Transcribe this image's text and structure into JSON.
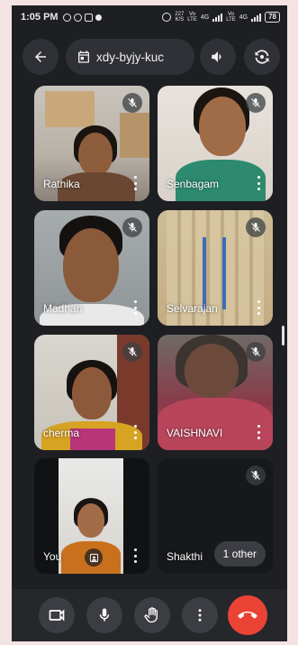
{
  "status_bar": {
    "time": "1:05 PM",
    "volte1_top": "227",
    "volte1_bottom": "K/S",
    "volte2_top": "Vo",
    "volte2_bottom": "LTE",
    "net1": "4G",
    "volte3_top": "Vo",
    "volte3_bottom": "LTE",
    "net2": "4G",
    "battery": "78"
  },
  "header": {
    "back_icon": "arrow-left-icon",
    "meeting_code": "xdy-byjy-kuc",
    "calendar_icon": "calendar-icon",
    "speaker_icon": "volume-icon",
    "switch_camera_icon": "camera-switch-icon"
  },
  "participants": [
    {
      "name": "Rathika",
      "muted": true
    },
    {
      "name": "Senbagam",
      "muted": true
    },
    {
      "name": "Madhan",
      "muted": true
    },
    {
      "name": "Selvarajan",
      "muted": true
    },
    {
      "name": "cherma",
      "muted": true
    },
    {
      "name": "VAISHNAVI",
      "muted": true
    },
    {
      "name": "You",
      "muted": false
    },
    {
      "name": "Shakthi",
      "muted": true
    }
  ],
  "other_count_label": "1 other",
  "controls": {
    "camera_icon": "video-camera-icon",
    "mic_icon": "microphone-icon",
    "hand_icon": "raise-hand-icon",
    "more_icon": "more-vertical-icon",
    "end_icon": "end-call-icon"
  },
  "colors": {
    "background": "#1e1f22",
    "control_bg": "#3c3d42",
    "end_call": "#ea4335"
  }
}
